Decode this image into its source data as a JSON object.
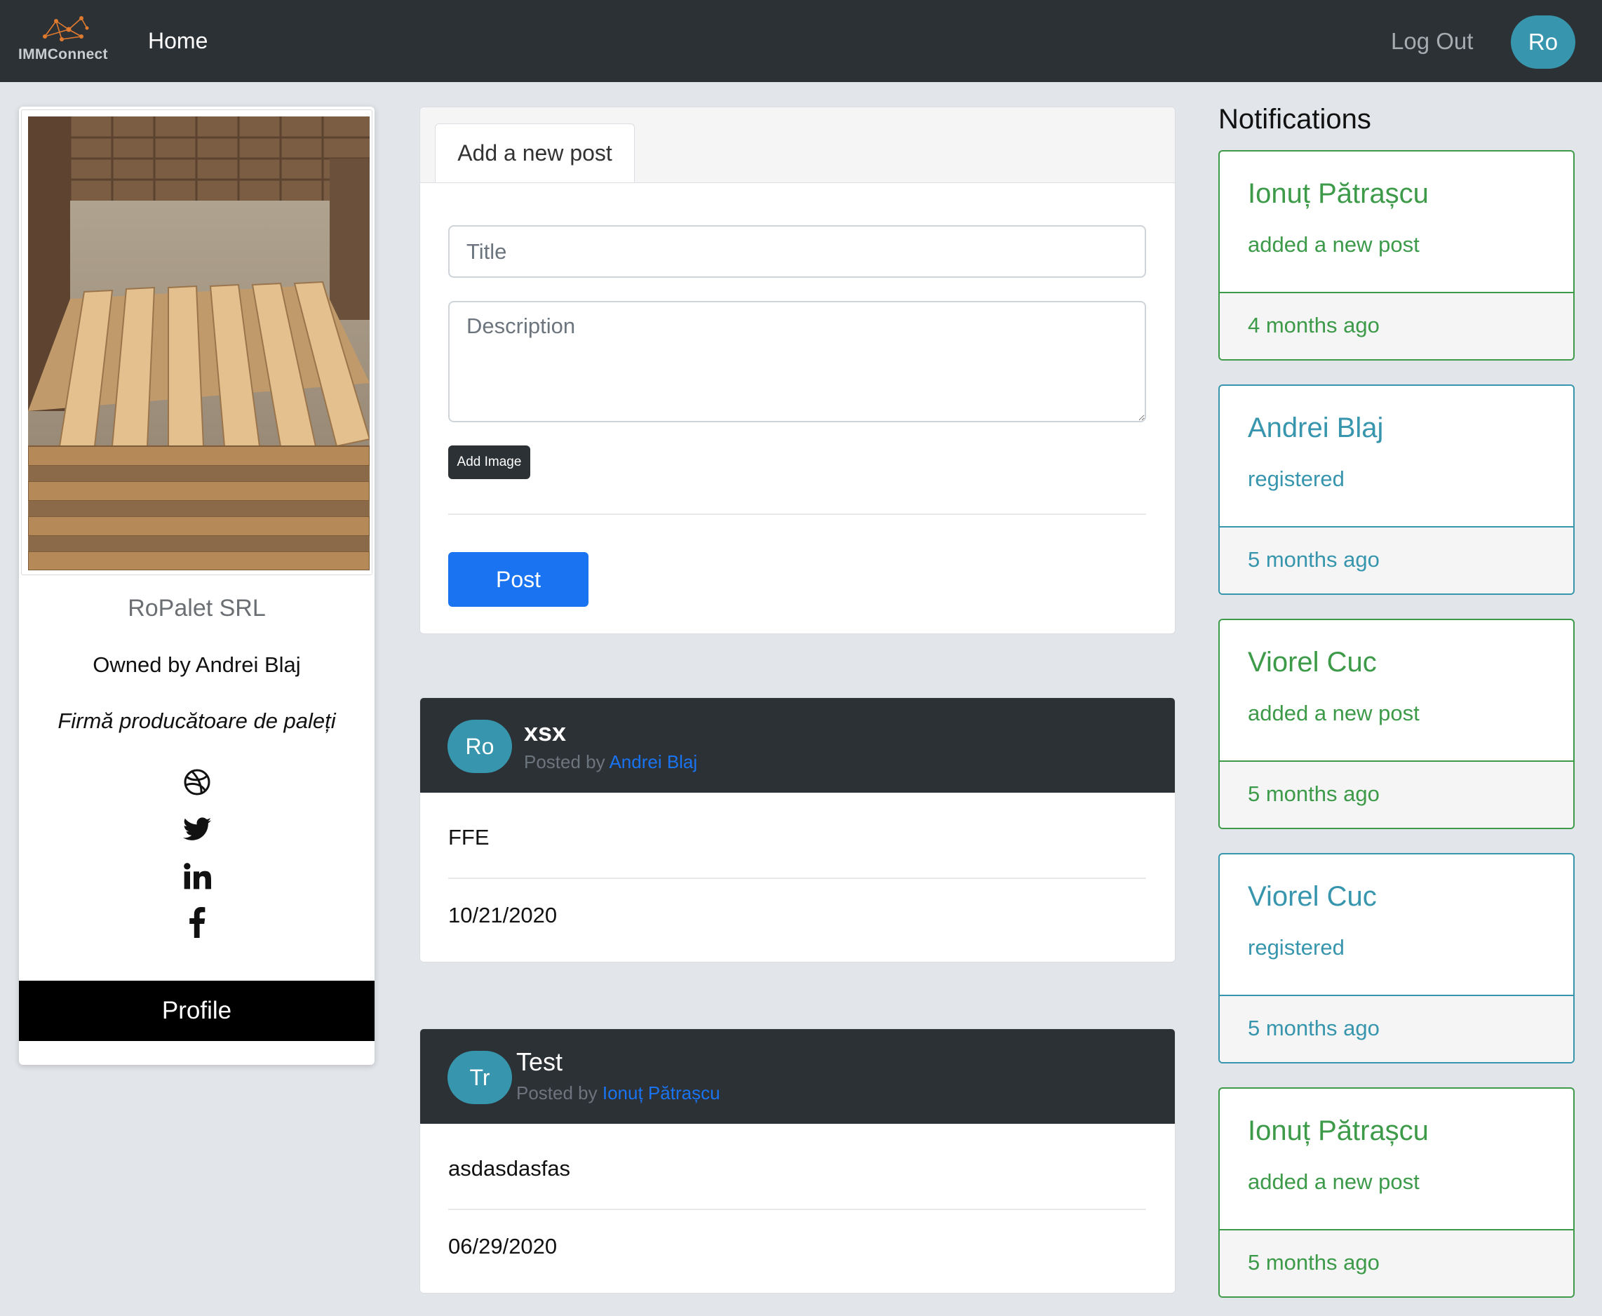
{
  "navbar": {
    "logo_text": "IMMConnect",
    "home_label": "Home",
    "logout_label": "Log Out",
    "user_initials": "Ro"
  },
  "profile": {
    "company_name": "RoPalet SRL",
    "owner": "Owned by Andrei Blaj",
    "tagline": "Firmă producătoare de paleți",
    "social_icons": [
      "dribbble-icon",
      "twitter-icon",
      "linkedin-icon",
      "facebook-icon"
    ],
    "profile_button": "Profile"
  },
  "new_post": {
    "tab_label": "Add a new post",
    "title_placeholder": "Title",
    "description_placeholder": "Description",
    "add_image_label": "Add Image",
    "post_button": "Post"
  },
  "posts": [
    {
      "avatar": "Ro",
      "title": "xsx",
      "posted_by_prefix": "Posted by",
      "author": "Andrei Blaj",
      "body": "FFE",
      "date": "10/21/2020"
    },
    {
      "avatar": "Tr",
      "title": "Test",
      "posted_by_prefix": "Posted by",
      "author": "Ionuț Pătrașcu",
      "body": "asdasdasfas",
      "date": "06/29/2020"
    }
  ],
  "notifications": {
    "heading": "Notifications",
    "items": [
      {
        "name": "Ionuț Pătrașcu",
        "action": "added a new post",
        "time": "4 months ago",
        "color": "#3c9a49"
      },
      {
        "name": "Andrei Blaj",
        "action": "registered",
        "time": "5 months ago",
        "color": "#3796ad"
      },
      {
        "name": "Viorel Cuc",
        "action": "added a new post",
        "time": "5 months ago",
        "color": "#3c9a49"
      },
      {
        "name": "Viorel Cuc",
        "action": "registered",
        "time": "5 months ago",
        "color": "#3796ad"
      },
      {
        "name": "Ionuț Pătrașcu",
        "action": "added a new post",
        "time": "5 months ago",
        "color": "#3c9a49"
      }
    ]
  },
  "colors": {
    "navbar": "#2c3136",
    "accent_teal": "#3796ad",
    "primary_blue": "#1a73f0",
    "notif_green": "#3c9a49"
  }
}
